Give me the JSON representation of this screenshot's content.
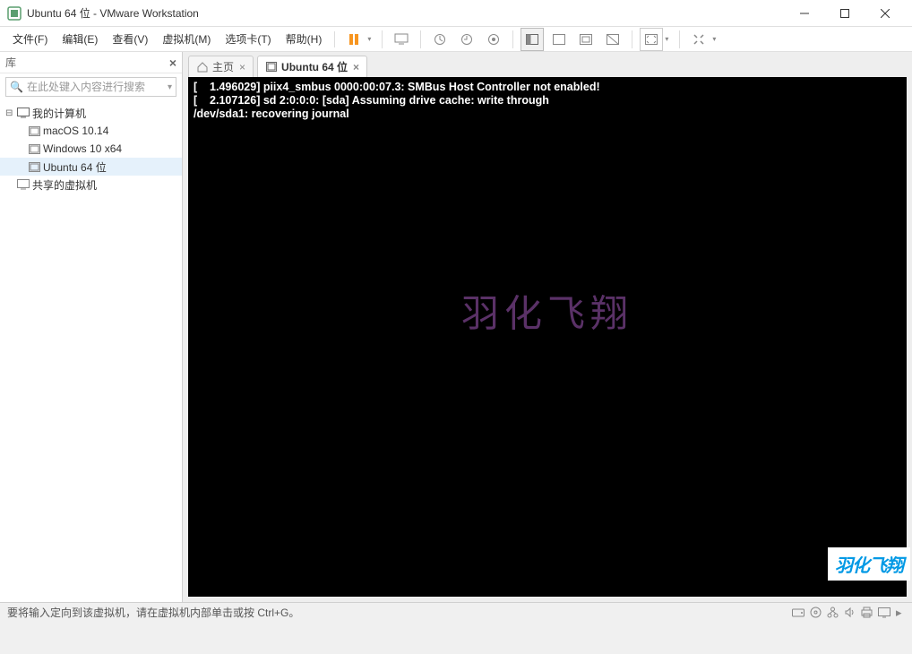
{
  "window": {
    "title": "Ubuntu 64 位 - VMware Workstation"
  },
  "menu": {
    "file": "文件(F)",
    "edit": "编辑(E)",
    "view": "查看(V)",
    "vm": "虚拟机(M)",
    "tabs": "选项卡(T)",
    "help": "帮助(H)"
  },
  "sidebar": {
    "title": "库",
    "search_placeholder": "在此处键入内容进行搜索",
    "my_computer": "我的计算机",
    "items": [
      {
        "label": "macOS 10.14"
      },
      {
        "label": "Windows 10 x64"
      },
      {
        "label": "Ubuntu 64 位"
      }
    ],
    "shared": "共享的虚拟机"
  },
  "tabs": {
    "home": "主页",
    "active": "Ubuntu 64 位"
  },
  "console": {
    "line1": "[    1.496029] piix4_smbus 0000:00:07.3: SMBus Host Controller not enabled!",
    "line2": "[    2.107126] sd 2:0:0:0: [sda] Assuming drive cache: write through",
    "line3": "/dev/sda1: recovering journal"
  },
  "watermark": "羽化飞翔",
  "corner_logo": "羽化飞翔",
  "statusbar": {
    "message": "要将输入定向到该虚拟机，请在虚拟机内部单击或按 Ctrl+G。"
  }
}
